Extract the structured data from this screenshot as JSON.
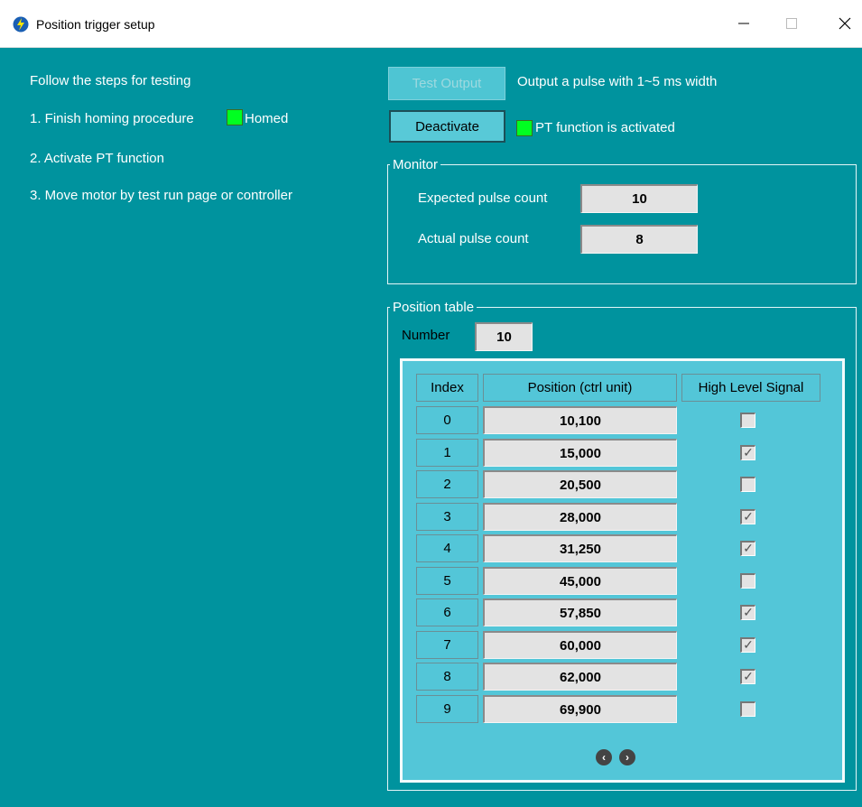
{
  "window": {
    "title": "Position trigger setup",
    "controls": {
      "minimize": "—",
      "maximize": "☐",
      "close": "✕"
    }
  },
  "steps": {
    "intro": "Follow the steps for testing",
    "step1": "1. Finish homing procedure",
    "homed_label": "Homed",
    "step2": "2. Activate PT function",
    "step3": "3. Move motor by test run page or controller"
  },
  "controls": {
    "test_output_label": "Test Output",
    "test_output_desc": "Output a pulse with 1~5 ms width",
    "deactivate_label": "Deactivate",
    "pt_status": "PT function is activated"
  },
  "monitor": {
    "legend": "Monitor",
    "expected_label": "Expected pulse count",
    "expected_value": "10",
    "actual_label": "Actual pulse count",
    "actual_value": "8"
  },
  "position_table": {
    "legend": "Position table",
    "number_label": "Number",
    "number_value": "10",
    "headers": {
      "index": "Index",
      "position": "Position (ctrl unit)",
      "signal": "High Level Signal"
    },
    "rows": [
      {
        "index": "0",
        "position": "10,100",
        "high": false
      },
      {
        "index": "1",
        "position": "15,000",
        "high": true
      },
      {
        "index": "2",
        "position": "20,500",
        "high": false
      },
      {
        "index": "3",
        "position": "28,000",
        "high": true
      },
      {
        "index": "4",
        "position": "31,250",
        "high": true
      },
      {
        "index": "5",
        "position": "45,000",
        "high": false
      },
      {
        "index": "6",
        "position": "57,850",
        "high": true
      },
      {
        "index": "7",
        "position": "60,000",
        "high": true
      },
      {
        "index": "8",
        "position": "62,000",
        "high": true
      },
      {
        "index": "9",
        "position": "69,900",
        "high": false
      }
    ],
    "nav": {
      "prev": "‹",
      "next": "›"
    }
  },
  "colors": {
    "background": "#00939e",
    "panel": "#53c6d8",
    "indicator_on": "#00ff21"
  }
}
